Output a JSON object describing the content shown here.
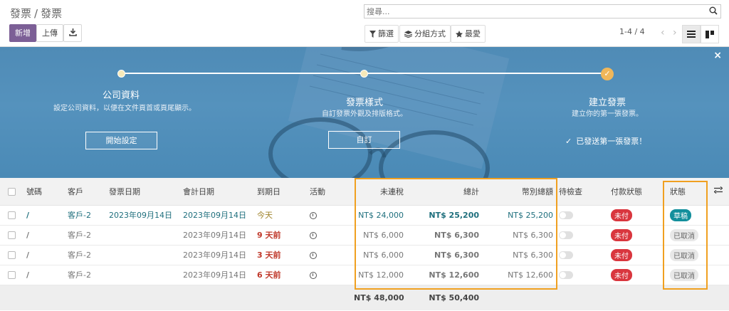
{
  "breadcrumb": {
    "parent": "發票",
    "separator": "/",
    "current": "發票"
  },
  "buttons": {
    "new": "新增",
    "upload": "上傳"
  },
  "search": {
    "placeholder": "搜尋..."
  },
  "filters": {
    "filter": "篩選",
    "group_by": "分組方式",
    "favorites": "最愛"
  },
  "pager": {
    "range": "1-4 / 4"
  },
  "onboarding": {
    "close": "×",
    "steps": [
      {
        "title": "公司資料",
        "description": "設定公司資料，以便在文件頁首或頁尾顯示。",
        "button": "開始設定"
      },
      {
        "title": "發票樣式",
        "description": "自訂發票外觀及排版格式。",
        "button": "自訂"
      },
      {
        "title": "建立發票",
        "description": "建立你的第一張發票。",
        "done_note": "已發送第一張發票！"
      }
    ]
  },
  "table": {
    "headers": {
      "number": "號碼",
      "customer": "客戶",
      "invoice_date": "發票日期",
      "accounting_date": "會計日期",
      "due_date": "到期日",
      "activity": "活動",
      "untaxed": "未連稅",
      "total": "總計",
      "currency_total": "幣別總額",
      "to_check": "待檢查",
      "payment_status": "付款狀態",
      "status": "狀態"
    },
    "rows": [
      {
        "number": "/",
        "customer": "客戶-2",
        "invoice_date": "2023年09月14日",
        "accounting_date": "2023年09月14日",
        "due_date": "今天",
        "untaxed": "NT$ 24,000",
        "total": "NT$ 25,200",
        "currency_total": "NT$ 25,200",
        "payment_status": "未付",
        "status": "草稿"
      },
      {
        "number": "/",
        "customer": "客戶-2",
        "invoice_date": "",
        "accounting_date": "2023年09月14日",
        "due_date": "9 天前",
        "untaxed": "NT$ 6,000",
        "total": "NT$ 6,300",
        "currency_total": "NT$ 6,300",
        "payment_status": "未付",
        "status": "已取消"
      },
      {
        "number": "/",
        "customer": "客戶-2",
        "invoice_date": "",
        "accounting_date": "2023年09月14日",
        "due_date": "3 天前",
        "untaxed": "NT$ 6,000",
        "total": "NT$ 6,300",
        "currency_total": "NT$ 6,300",
        "payment_status": "未付",
        "status": "已取消"
      },
      {
        "number": "/",
        "customer": "客戶-2",
        "invoice_date": "",
        "accounting_date": "2023年09月14日",
        "due_date": "6 天前",
        "untaxed": "NT$ 12,000",
        "total": "NT$ 12,600",
        "currency_total": "NT$ 12,600",
        "payment_status": "未付",
        "status": "已取消"
      }
    ],
    "totals": {
      "untaxed": "NT$ 48,000",
      "total": "NT$ 50,400"
    }
  },
  "colors": {
    "primary": "#7c5f96",
    "highlight": "#f0a020",
    "banner": "#4f8bb6",
    "unpaid": "#d9363e",
    "draft": "#138f9c"
  }
}
